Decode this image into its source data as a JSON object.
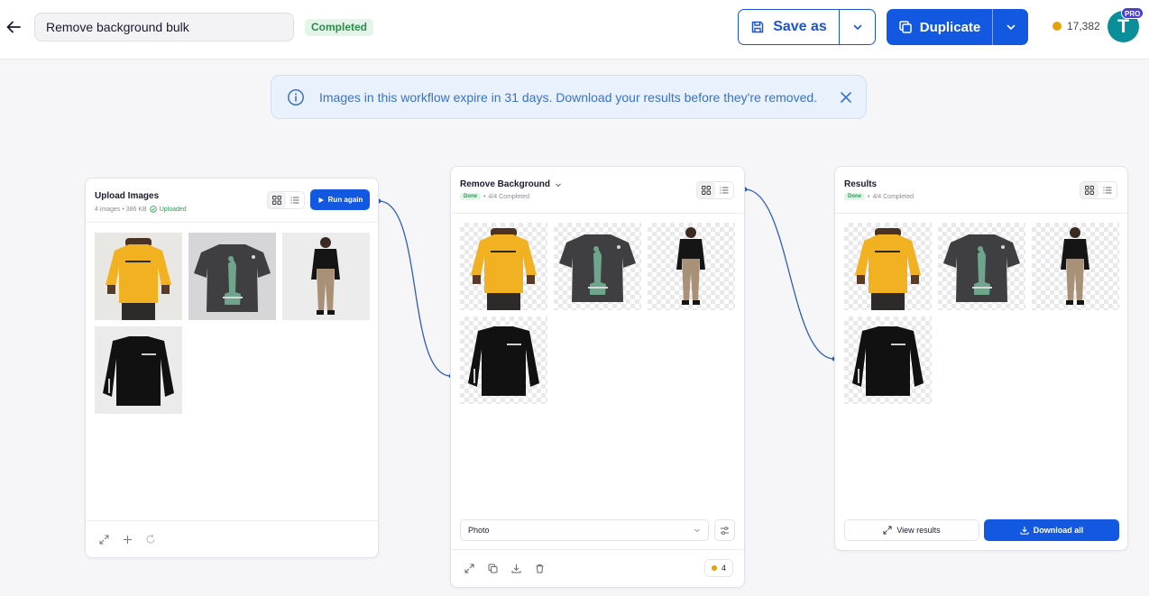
{
  "header": {
    "workflow_name": "Remove background bulk",
    "status": "Completed",
    "save_label": "Save as",
    "duplicate_label": "Duplicate",
    "credits": "17,382",
    "avatar_initial": "T",
    "plan_badge": "PRO"
  },
  "notice": {
    "text": "Images in this workflow expire in 31 days. Download your results before they're removed."
  },
  "upload_card": {
    "title": "Upload Images",
    "meta": "4 images • 386 KB",
    "status": "Uploaded",
    "run_label": "Run again",
    "images": [
      "yellow-tshirt",
      "black-tshirt-paris",
      "black-sweater-model",
      "black-sweatshirt"
    ]
  },
  "remove_card": {
    "title": "Remove Background",
    "badge": "Done",
    "progress": "4/4 Completed",
    "mode": "Photo",
    "cost": "4",
    "images": [
      "yellow-tshirt",
      "black-tshirt-paris",
      "black-sweater-model",
      "black-sweatshirt"
    ]
  },
  "results_card": {
    "title": "Results",
    "badge": "Done",
    "progress": "4/4 Completed",
    "view_label": "View results",
    "download_label": "Download all",
    "images": [
      "yellow-tshirt",
      "black-tshirt-paris",
      "black-sweater-model",
      "black-sweatshirt"
    ]
  },
  "colors": {
    "accent": "#1358e0",
    "success": "#2f9a55",
    "notice_text": "#3a72c4",
    "wire": "#2c5fb3"
  }
}
